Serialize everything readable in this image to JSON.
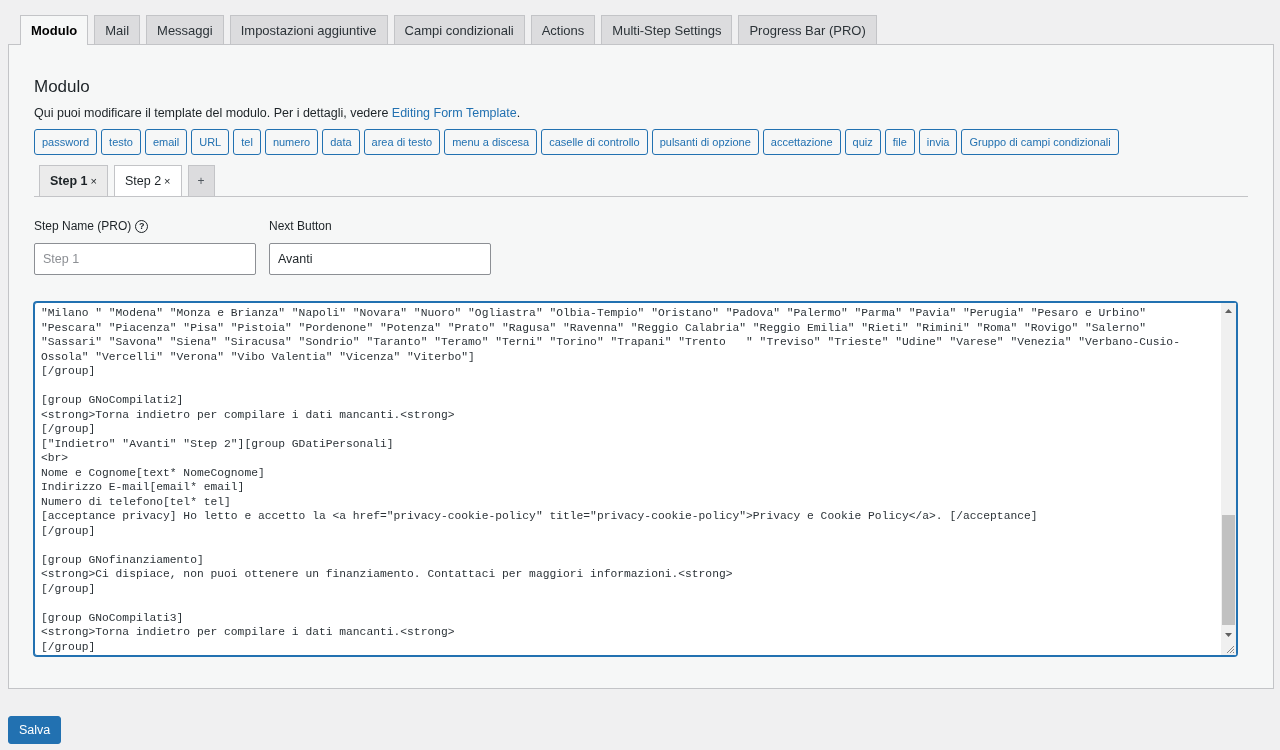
{
  "tabs": [
    {
      "label": "Modulo",
      "selected": true
    },
    {
      "label": "Mail",
      "selected": false
    },
    {
      "label": "Messaggi",
      "selected": false
    },
    {
      "label": "Impostazioni aggiuntive",
      "selected": false
    },
    {
      "label": "Campi condizionali",
      "selected": false
    },
    {
      "label": "Actions",
      "selected": false
    },
    {
      "label": "Multi-Step Settings",
      "selected": false
    },
    {
      "label": "Progress Bar (PRO)",
      "selected": false
    }
  ],
  "panel": {
    "title": "Modulo",
    "description": "Qui puoi modificare il template del modulo. Per i dettagli, vedere ",
    "description_link": "Editing Form Template",
    "description_end": ".",
    "tag_buttons": [
      "password",
      "testo",
      "email",
      "URL",
      "tel",
      "numero",
      "data",
      "area di testo",
      "menu a discesa",
      "caselle di controllo",
      "pulsanti di opzione",
      "accettazione",
      "quiz",
      "file",
      "invia",
      "Gruppo di campi condizionali"
    ],
    "step_tabs": [
      {
        "label": "Step 1",
        "close": "×",
        "selected": true
      },
      {
        "label": "Step 2",
        "close": "×",
        "selected": false
      }
    ],
    "add_step": "+",
    "step_name": {
      "label": "Step Name (PRO)",
      "help": "?",
      "placeholder": "Step 1"
    },
    "next_button": {
      "label": "Next Button",
      "value": "Avanti"
    },
    "editor_blocks": [
      [
        "\"Milano \" \"Modena\" \"Monza e Brianza\" \"Napoli\" \"Novara\" \"Nuoro\" \"Ogliastra\" \"Olbia-Tempio\" \"Oristano\" \"Padova\" \"Palermo\" \"Parma\" \"Pavia\" \"Perugia\" \"Pesaro e Urbino\"",
        "\"Pescara\" \"Piacenza\" \"Pisa\" \"Pistoia\" \"Pordenone\" \"Potenza\" \"Prato\" \"Ragusa\" \"Ravenna\" \"Reggio Calabria\" \"Reggio Emilia\" \"Rieti\" \"Rimini\" \"Roma\" \"Rovigo\" \"Salerno\"",
        "\"Sassari\" \"Savona\" \"Siena\" \"Siracusa\" \"Sondrio\" \"Taranto\" \"Teramo\" \"Terni\" \"Torino\" \"Trapani\" \"Trento   \" \"Treviso\" \"Trieste\" \"Udine\" \"Varese\" \"Venezia\" \"Verbano-Cusio-",
        "Ossola\" \"Vercelli\" \"Verona\" \"Vibo Valentia\" \"Vicenza\" \"Viterbo\"]",
        "[/group]"
      ],
      [
        "[group GNoCompilati2]",
        "<strong>Torna indietro per compilare i dati mancanti.<strong>",
        "[/group]",
        "[\"Indietro\" \"Avanti\" \"Step 2\"][group GDatiPersonali]",
        "<br>",
        "Nome e Cognome[text* NomeCognome]",
        "Indirizzo E-mail[email* email]",
        "Numero di telefono[tel* tel]",
        "[acceptance privacy] Ho letto e accetto la <a href=\"privacy-cookie-policy\" title=\"privacy-cookie-policy\">Privacy e Cookie Policy</a>. [/acceptance]",
        "[/group]"
      ],
      [
        "[group GNofinanziamento]",
        "<strong>Ci dispiace, non puoi ottenere un finanziamento. Contattaci per maggiori informazioni.<strong>",
        "[/group]"
      ],
      [
        "[group GNoCompilati3]",
        "<strong>Torna indietro per compilare i dati mancanti.<strong>",
        "[/group]"
      ]
    ]
  },
  "save_button": "Salva"
}
